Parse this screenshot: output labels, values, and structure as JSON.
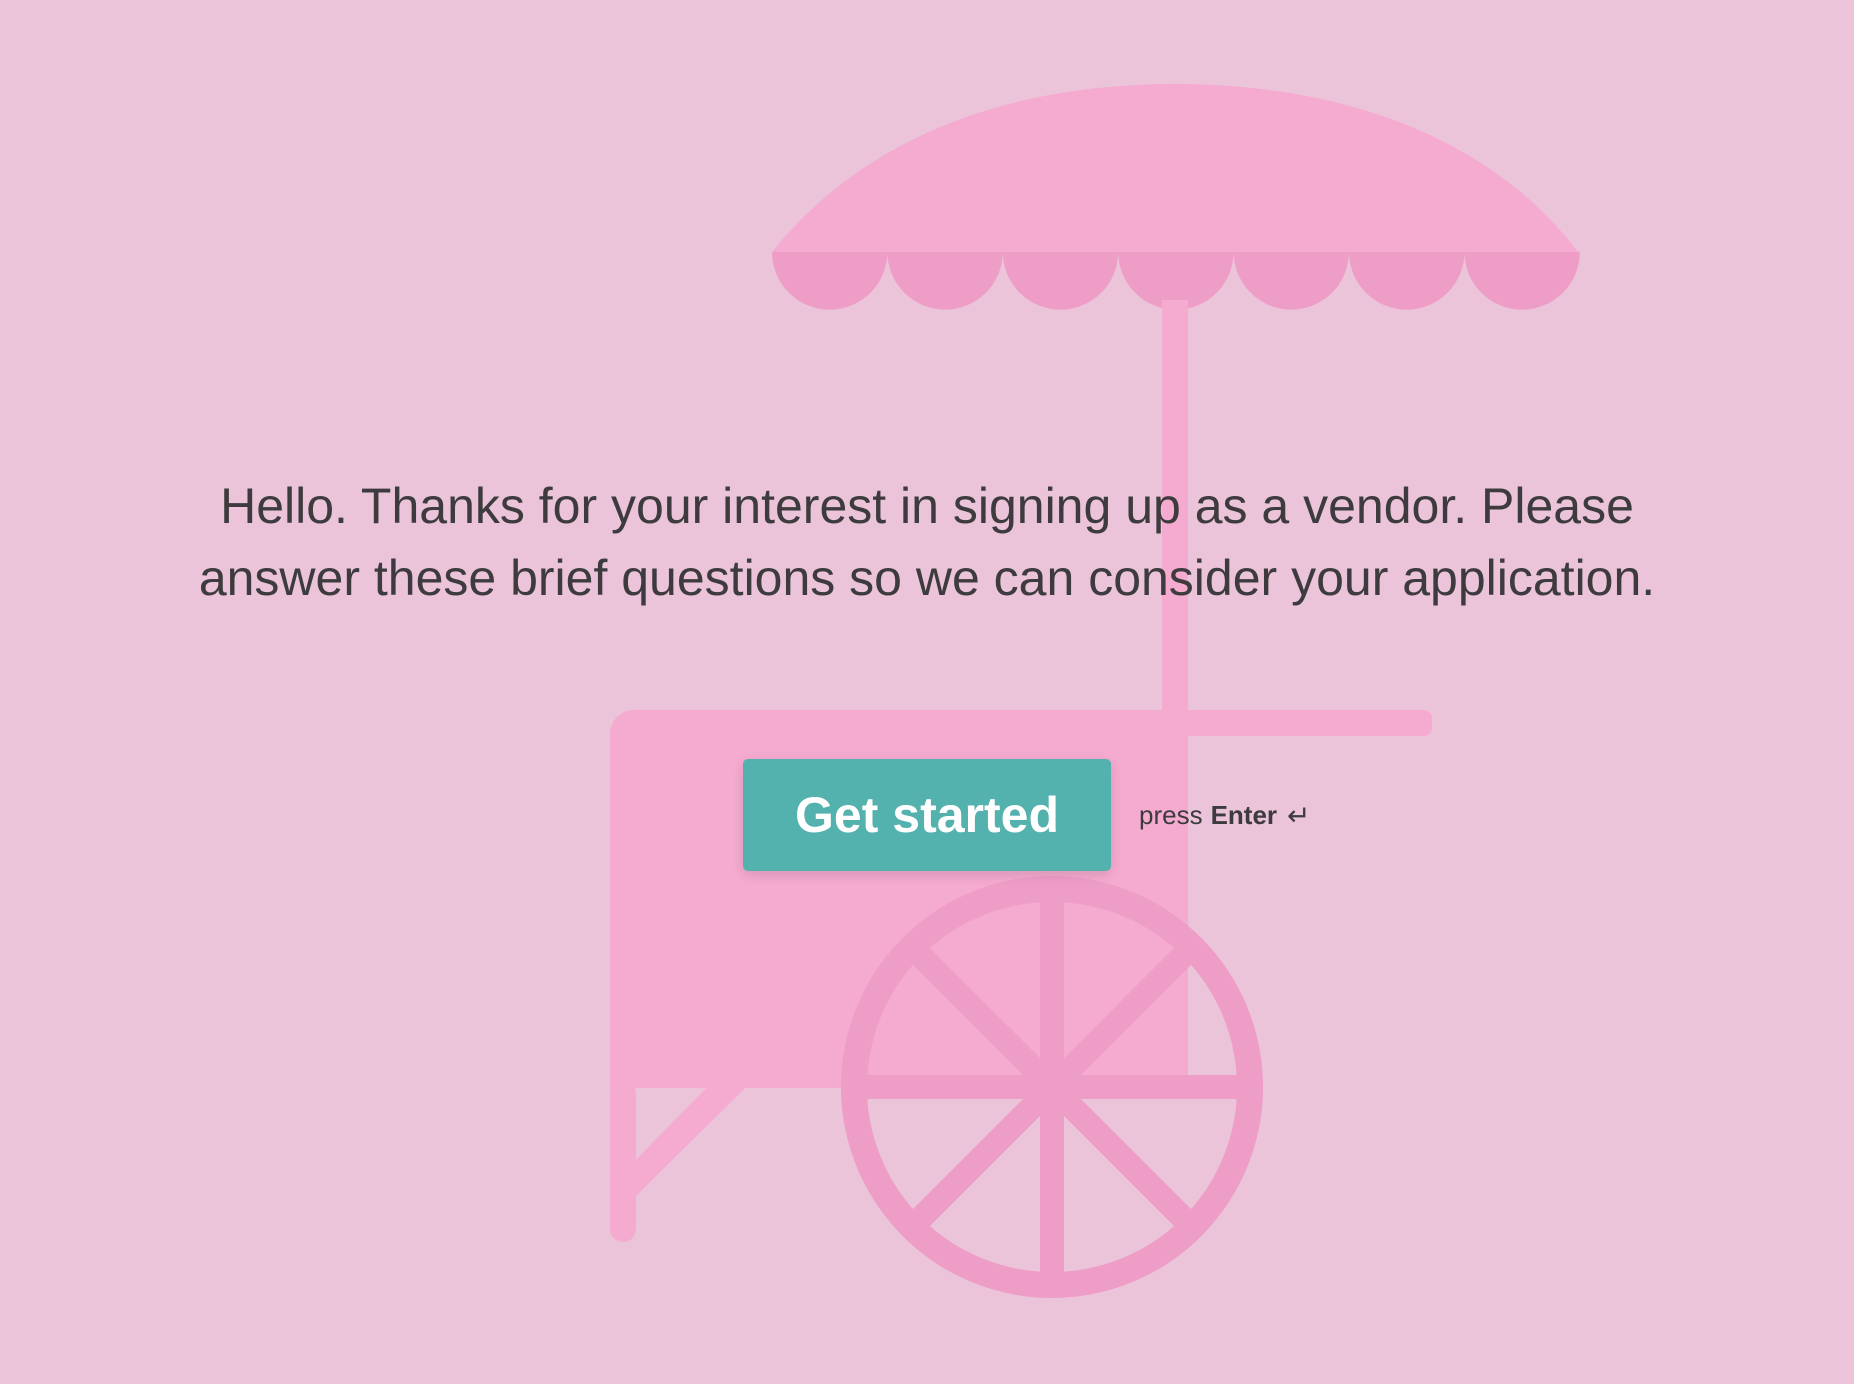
{
  "welcome": {
    "message": "Hello. Thanks for your interest in signing up as a vendor. Please answer these brief questions so we can consider your application."
  },
  "cta": {
    "button_label": "Get started",
    "hint_prefix": "press",
    "hint_key": "Enter",
    "hint_icon": "↵"
  },
  "colors": {
    "background": "#ebc4da",
    "cart_body": "#f5aacf",
    "cart_accent": "#ee9dc7",
    "button": "#53b1ae",
    "text": "#3d3b3d"
  }
}
